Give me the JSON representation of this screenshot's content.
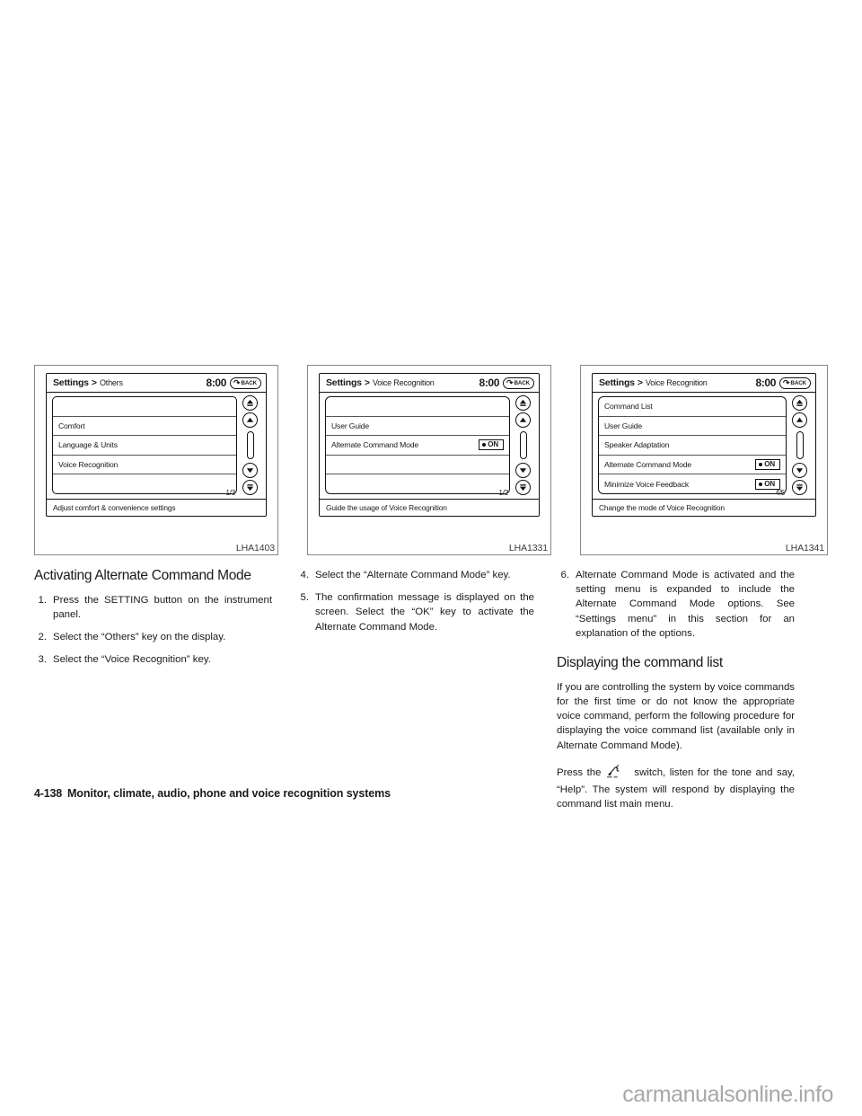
{
  "figures": [
    {
      "id": "LHA1403",
      "screen": {
        "breadcrumb_main": "Settings",
        "breadcrumb_sep": ">",
        "breadcrumb_sub": "Others",
        "clock": "8:00",
        "back_label": "BACK",
        "rows": [
          {
            "label": "",
            "blank": true
          },
          {
            "label": "Comfort"
          },
          {
            "label": "Language & Units"
          },
          {
            "label": "Voice Recognition"
          },
          {
            "label": "",
            "blank": true
          }
        ],
        "page_index": "1/3",
        "status": "Adjust comfort & convenience settings"
      }
    },
    {
      "id": "LHA1331",
      "screen": {
        "breadcrumb_main": "Settings",
        "breadcrumb_sep": ">",
        "breadcrumb_sub": "Voice Recognition",
        "clock": "8:00",
        "back_label": "BACK",
        "rows": [
          {
            "label": "",
            "blank": true
          },
          {
            "label": "User Guide"
          },
          {
            "label": "Alternate Command Mode",
            "toggle": "ON"
          },
          {
            "label": "",
            "blank": true
          },
          {
            "label": "",
            "blank": true
          }
        ],
        "page_index": "1/2",
        "status": "Guide the usage of Voice Recognition"
      }
    },
    {
      "id": "LHA1341",
      "screen": {
        "breadcrumb_main": "Settings",
        "breadcrumb_sep": ">",
        "breadcrumb_sub": "Voice Recognition",
        "clock": "8:00",
        "back_label": "BACK",
        "rows": [
          {
            "label": "Command List"
          },
          {
            "label": "User Guide"
          },
          {
            "label": "Speaker Adaptation"
          },
          {
            "label": "Alternate Command Mode",
            "toggle": "ON"
          },
          {
            "label": "Minimize Voice Feedback",
            "toggle": "ON"
          }
        ],
        "page_index": "4/5",
        "status": "Change the mode of Voice Recognition"
      }
    }
  ],
  "body": {
    "section_title": "Activating Alternate Command Mode",
    "steps": [
      {
        "num": "1.",
        "text": "Press the SETTING button on the instrument panel."
      },
      {
        "num": "2.",
        "text": "Select the “Others” key on the display."
      },
      {
        "num": "3.",
        "text": "Select the “Voice Recognition” key."
      },
      {
        "num": "4.",
        "text": "Select the “Alternate Command Mode” key."
      },
      {
        "num": "5.",
        "text": "The confirmation message is displayed on the screen. Select the “OK” key to activate the Alternate Command Mode."
      },
      {
        "num": "6.",
        "text": "Alternate Command Mode is activated and the setting menu is expanded to include the Alternate Command Mode options. See “Settings menu” in this section for an explanation of the options."
      }
    ],
    "subsection_title": "Displaying the command list",
    "paragraph_1": "If you are controlling the system by voice commands for the first time or do not know the appropriate voice command, perform the following procedure for displaying the voice command list (available only in Alternate Command Mode).",
    "paragraph_2_pre": "Press the",
    "paragraph_2_post": "switch, listen for the tone and say, “Help”. The system will respond by displaying the command list main menu."
  },
  "footer": {
    "folio": "4-138",
    "running_head": "Monitor, climate, audio, phone and voice recognition systems"
  },
  "watermark": "carmanualsonline.info"
}
